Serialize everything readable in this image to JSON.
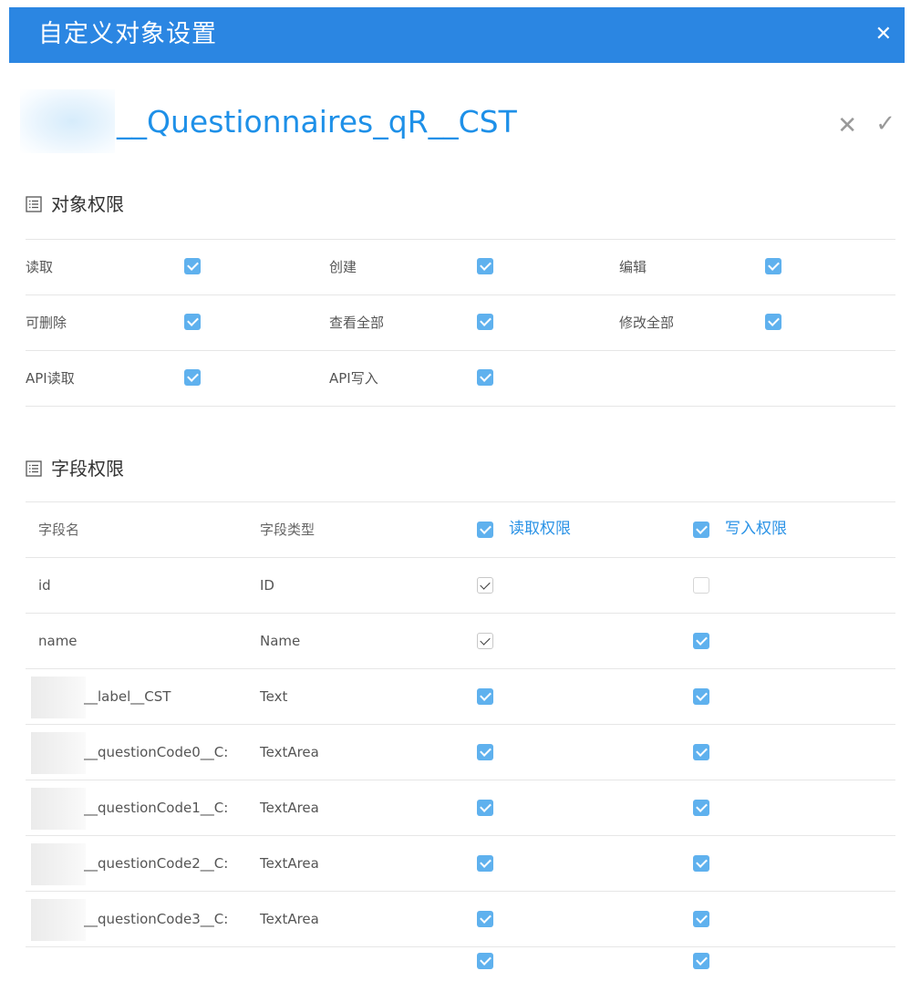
{
  "dialog": {
    "title": "自定义对象设置",
    "close_icon": "close-icon"
  },
  "object": {
    "name": "__Questionnaires_qR__CST",
    "cancel_icon": "cancel-icon",
    "confirm_icon": "check-icon"
  },
  "object_permissions": {
    "title": "对象权限",
    "rows": [
      [
        {
          "label": "读取",
          "checked": true
        },
        {
          "label": "创建",
          "checked": true
        },
        {
          "label": "编辑",
          "checked": true
        }
      ],
      [
        {
          "label": "可删除",
          "checked": true
        },
        {
          "label": "查看全部",
          "checked": true
        },
        {
          "label": "修改全部",
          "checked": true
        }
      ],
      [
        {
          "label": "API读取",
          "checked": true
        },
        {
          "label": "API写入",
          "checked": true
        }
      ]
    ]
  },
  "field_permissions": {
    "title": "字段权限",
    "columns": {
      "name": "字段名",
      "type": "字段类型",
      "read": "读取权限",
      "write": "写入权限"
    },
    "rows": [
      {
        "name": "id",
        "type": "ID",
        "read": "checked-disabled",
        "write": "unchecked-disabled"
      },
      {
        "name": "name",
        "type": "Name",
        "read": "checked-disabled",
        "write": "checked"
      },
      {
        "name": "__label__CST",
        "type": "Text",
        "read": "checked",
        "write": "checked",
        "prefix_hidden": true
      },
      {
        "name": "__questionCode0__C:",
        "type": "TextArea",
        "read": "checked",
        "write": "checked",
        "prefix_hidden": true
      },
      {
        "name": "__questionCode1__C:",
        "type": "TextArea",
        "read": "checked",
        "write": "checked",
        "prefix_hidden": true
      },
      {
        "name": "__questionCode2__C:",
        "type": "TextArea",
        "read": "checked",
        "write": "checked",
        "prefix_hidden": true
      },
      {
        "name": "__questionCode3__C:",
        "type": "TextArea",
        "read": "checked",
        "write": "checked",
        "prefix_hidden": true
      }
    ]
  },
  "colors": {
    "header": "#2b86e2",
    "accent": "#1e90e8",
    "checkbox": "#5fb1ee"
  }
}
